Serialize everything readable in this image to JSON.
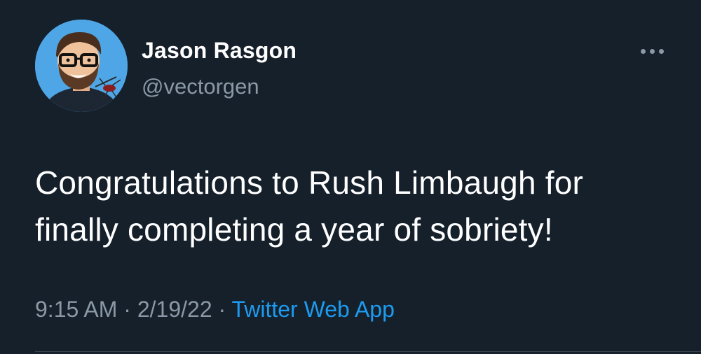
{
  "tweet": {
    "author_name": "Jason Rasgon",
    "author_handle": "@vectorgen",
    "text_lines": [
      "Congratulations to Rush Limbaugh for",
      "finally completing a year of sobriety!"
    ],
    "time": "9:15 AM",
    "date": "2/19/22",
    "separator": "·",
    "source": "Twitter Web App"
  },
  "icons": {
    "more": "more-options-icon",
    "avatar": "avatar-cartoon-portrait"
  },
  "colors": {
    "background": "#15202b",
    "primary_text": "#ffffff",
    "secondary_text": "#8b98a5",
    "link": "#1d9bf0",
    "avatar_background": "#4fa6e6",
    "divider": "#38444d"
  }
}
